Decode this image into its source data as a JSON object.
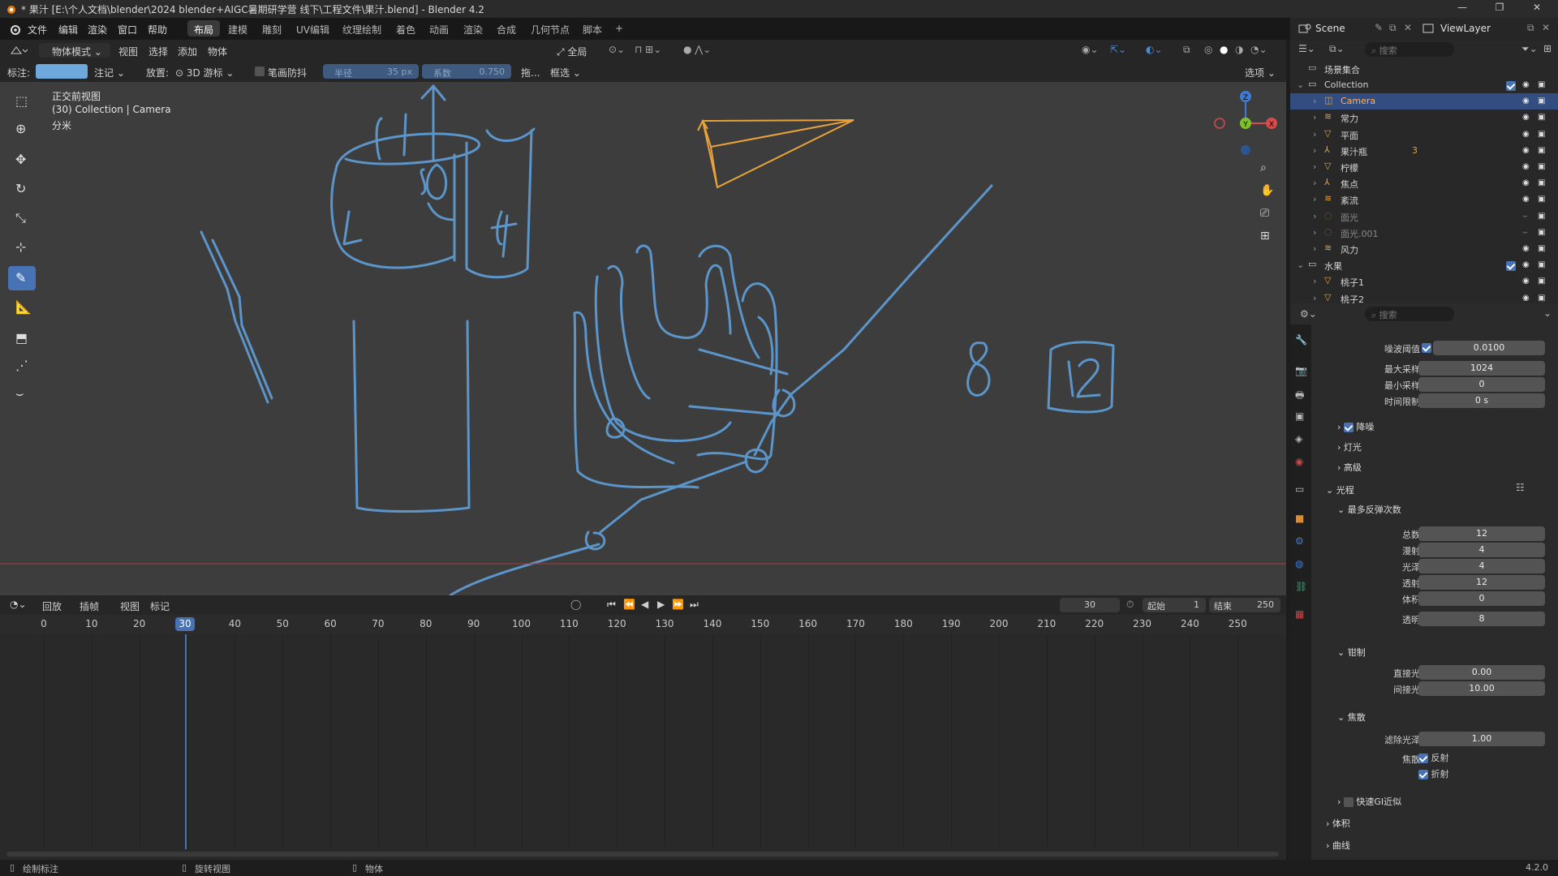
{
  "window": {
    "title": "* 果汁 [E:\\个人文档\\blender\\2024 blender+AIGC暑期研学营 线下\\工程文件\\果汁.blend] - Blender 4.2"
  },
  "menu": {
    "items": [
      "文件",
      "编辑",
      "渲染",
      "窗口",
      "帮助"
    ]
  },
  "workspaces": [
    "布局",
    "建模",
    "雕刻",
    "UV编辑",
    "纹理绘制",
    "着色",
    "动画",
    "渲染",
    "合成",
    "几何节点",
    "脚本",
    "+"
  ],
  "scene": {
    "name": "Scene",
    "view_layer": "ViewLayer"
  },
  "viewport_header": {
    "mode": "物体模式",
    "menus": [
      "视图",
      "选择",
      "添加",
      "物体"
    ],
    "orientation": "全局"
  },
  "tool_settings": {
    "annotate_label": "标注:",
    "annotate_mode": "注记",
    "placement_label": "放置:",
    "placement_value": "3D 游标",
    "stabilize_label": "笔画防抖",
    "radius_label": "半径",
    "radius_value": "35 px",
    "factor_label": "系数",
    "factor_value": "0.750",
    "drag_label": "拖...",
    "select_label": "框选",
    "options_label": "选项",
    "accent_color": "#6fa8dc"
  },
  "viewport": {
    "view_name": "正交前视图",
    "collection_info": "(30) Collection | Camera",
    "units": "分米",
    "annotation_color": "#5b95c9",
    "camera_color": "#e8a33a"
  },
  "outliner": {
    "search_placeholder": "搜索",
    "root": "场景集合",
    "rows": [
      {
        "name": "Collection",
        "type": "collection"
      },
      {
        "name": "Camera",
        "type": "camera",
        "selected": true
      },
      {
        "name": "常力",
        "type": "force"
      },
      {
        "name": "平面",
        "type": "mesh"
      },
      {
        "name": "果汁瓶",
        "type": "armature",
        "extra": "3"
      },
      {
        "name": "柠檬",
        "type": "mesh"
      },
      {
        "name": "焦点",
        "type": "empty"
      },
      {
        "name": "紊流",
        "type": "force"
      },
      {
        "name": "面光",
        "type": "light",
        "dim": true
      },
      {
        "name": "面光.001",
        "type": "light",
        "dim": true
      },
      {
        "name": "风力",
        "type": "force"
      },
      {
        "name": "水果",
        "type": "collection"
      },
      {
        "name": "桃子1",
        "type": "mesh"
      },
      {
        "name": "桃子2",
        "type": "mesh"
      }
    ]
  },
  "properties": {
    "search_placeholder": "搜索",
    "sampling": {
      "noise_threshold_label": "噪波阈值",
      "noise_threshold": "0.0100",
      "max_samples_label": "最大采样",
      "max_samples": "1024",
      "min_samples_label": "最小采样",
      "min_samples": "0",
      "time_limit_label": "时间限制",
      "time_limit": "0 s"
    },
    "denoise_label": "降噪",
    "lights_label": "灯光",
    "advanced_label": "高级",
    "light_paths_label": "光程",
    "max_bounces_label": "最多反弹次数",
    "bounces": [
      {
        "label": "总数",
        "value": "12"
      },
      {
        "label": "漫射",
        "value": "4"
      },
      {
        "label": "光泽",
        "value": "4"
      },
      {
        "label": "透射",
        "value": "12"
      },
      {
        "label": "体积",
        "value": "0"
      },
      {
        "label": "透明",
        "value": "8"
      }
    ],
    "clamp_label": "钳制",
    "clamp": [
      {
        "label": "直接光",
        "value": "0.00"
      },
      {
        "label": "间接光",
        "value": "10.00"
      }
    ],
    "caustics_label": "焦散",
    "filter_glossy_label": "滤除光泽",
    "filter_glossy": "1.00",
    "caustics_row_label": "焦散",
    "reflective_label": "反射",
    "refractive_label": "折射",
    "fast_gi_label": "快速GI近似",
    "volumes_label": "体积",
    "curves_label": "曲线"
  },
  "timeline": {
    "menus": [
      "回放",
      "插帧",
      "视图",
      "标记"
    ],
    "current_frame": "30",
    "start_label": "起始",
    "start": "1",
    "end_label": "结束",
    "end": "250",
    "ticks": [
      "0",
      "10",
      "20",
      "30",
      "40",
      "50",
      "60",
      "70",
      "80",
      "90",
      "100",
      "110",
      "120",
      "130",
      "140",
      "150",
      "160",
      "170",
      "180",
      "190",
      "200",
      "210",
      "220",
      "230",
      "240",
      "250"
    ]
  },
  "statusbar": {
    "left": "绘制标注",
    "middle": "旋转视图",
    "right": "物体",
    "version": "4.2.0"
  }
}
